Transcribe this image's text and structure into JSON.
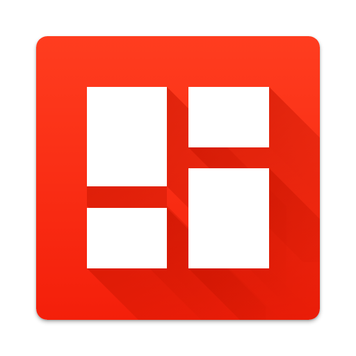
{
  "icon": {
    "name": "layout-grid-app-icon",
    "colors": {
      "background_top": "#ff3d1f",
      "background_bottom": "#f41f0a",
      "long_shadow": "#c81400",
      "tile": "#ffffff"
    },
    "tile_count": 4
  }
}
